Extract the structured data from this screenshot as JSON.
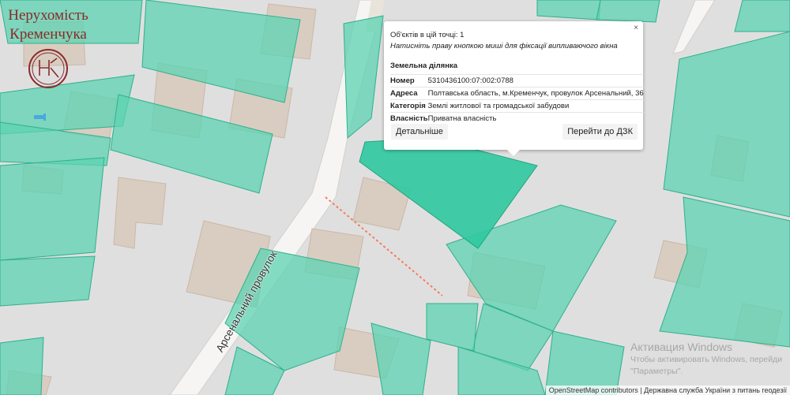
{
  "branding": {
    "line1": "Нерухомість",
    "line2": "Кременчука",
    "monogram": "НК",
    "color": "#8b2a2a"
  },
  "map": {
    "street_label": "Арсенальний провулок",
    "colors": {
      "background": "#e0dfdf",
      "building": "#d9cdc1",
      "parcel": "#5cd3b1",
      "parcel_selected": "#2fc9a0",
      "road": "#f6f5f3",
      "path": "#f07f5e"
    }
  },
  "popup": {
    "close_icon": "×",
    "count_text": "Об'єктів в цій точці: 1",
    "hint_text": "Натисніть праву кнопкою миші для фіксації випливаючого вікна",
    "section_title": "Земельна ділянка",
    "rows": [
      {
        "key": "Номер",
        "value": "5310436100:07:002:0788"
      },
      {
        "key": "Адреса",
        "value": "Полтавська область, м.Кременчук, провулок Арсенальний, 36"
      },
      {
        "key": "Категорія",
        "value": "Землі житлової та громадської забудови"
      },
      {
        "key": "Власність",
        "value": "Приватна власність"
      }
    ],
    "more_button": "Детальніше",
    "dzk_button": "Перейти до ДЗК"
  },
  "overlay": {
    "activation_title": "Активация Windows",
    "activation_line1": "Чтобы активировать Windows, перейди",
    "activation_line2": "\"Параметры\"."
  },
  "attribution": "OpenStreetMap contributors | Державна служба України з питань геодезії"
}
